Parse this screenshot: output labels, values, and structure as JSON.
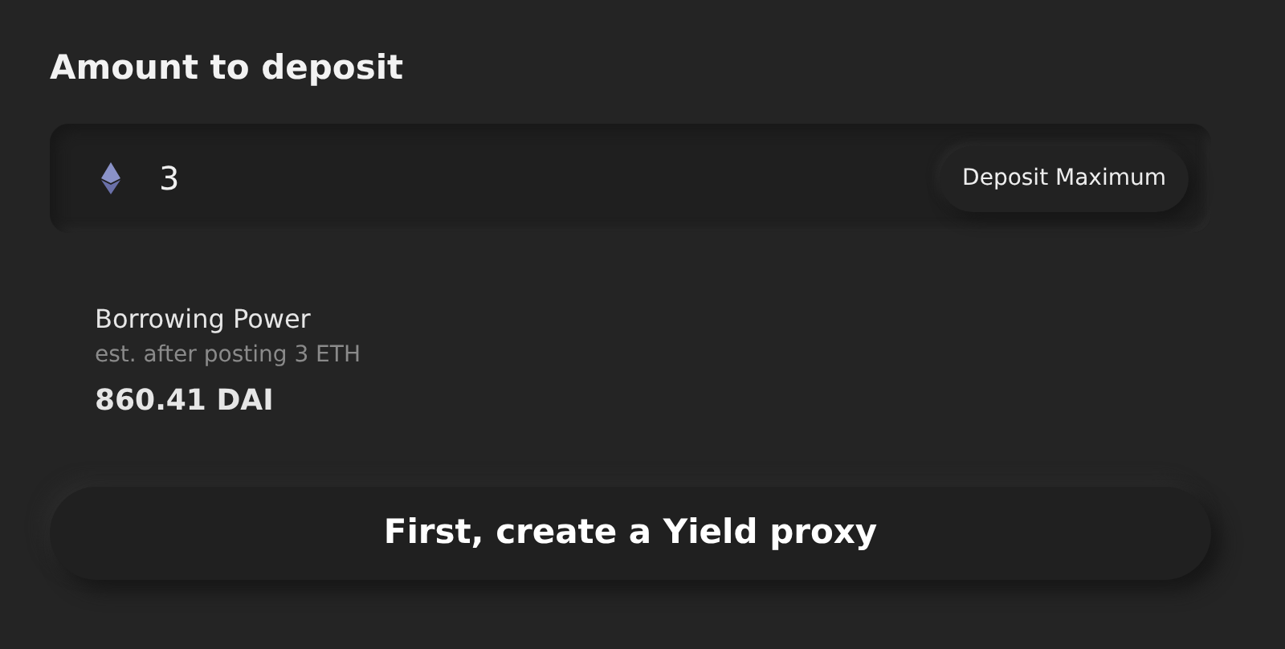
{
  "heading": "Amount to deposit",
  "amount_field": {
    "value": "3"
  },
  "max_button": "Deposit Maximum",
  "borrowing": {
    "label": "Borrowing Power",
    "note": "est. after posting 3 ETH",
    "value": "860.41 DAI"
  },
  "action_button": "First, create a Yield proxy"
}
